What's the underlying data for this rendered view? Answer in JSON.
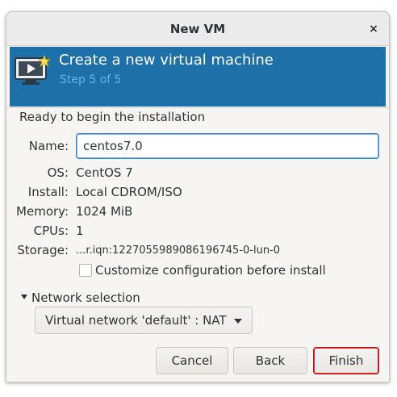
{
  "window": {
    "title": "New VM",
    "close_glyph": "×"
  },
  "banner": {
    "title": "Create a new virtual machine",
    "step": "Step 5 of 5",
    "icon": "monitor-play-icon",
    "color": "#1e71a8"
  },
  "summary": {
    "heading": "Ready to begin the installation",
    "name_label": "Name:",
    "name_value": "centos7.0",
    "os_label": "OS:",
    "os_value": "CentOS 7",
    "install_label": "Install:",
    "install_value": "Local CDROM/ISO",
    "memory_label": "Memory:",
    "memory_value": "1024 MiB",
    "cpus_label": "CPUs:",
    "cpus_value": "1",
    "storage_label": "Storage:",
    "storage_value": "...r.iqn:1227055989086196745-0-lun-0"
  },
  "customize": {
    "label": "Customize configuration before install",
    "checked": false
  },
  "network": {
    "expander_label": "Network selection",
    "selected": "Virtual network 'default' : NAT"
  },
  "buttons": {
    "cancel": "Cancel",
    "back": "Back",
    "finish": "Finish"
  }
}
